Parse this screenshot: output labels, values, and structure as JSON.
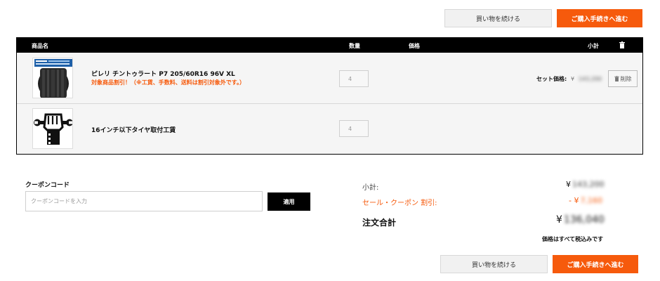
{
  "actions": {
    "continue_label": "買い物を続ける",
    "checkout_label": "ご購入手続きへ進む"
  },
  "cart": {
    "headers": {
      "product": "商品名",
      "quantity": "数量",
      "price": "価格",
      "subtotal": "小計",
      "trash_icon": "trash-icon"
    },
    "items": [
      {
        "name": "ピレリ チントゥラート P7 205/60R16 96V XL",
        "note": "対象商品割引！（※工賃、手数料、送料は割引対象外です。）",
        "quantity": "4",
        "set_price_label": "セット価格:",
        "set_price_currency": "¥",
        "set_price_value": "143,200",
        "delete_label": "削除",
        "image": "tire-icon"
      },
      {
        "name": "16インチ以下タイヤ取付工賃",
        "quantity": "4",
        "image": "wrench-fist-icon"
      }
    ]
  },
  "coupon": {
    "title": "クーポンコード",
    "placeholder": "クーポンコードを入力",
    "apply_label": "適用"
  },
  "summary": {
    "subtotal_label": "小計:",
    "subtotal_currency": "¥",
    "subtotal_value": "143,200",
    "discount_label": "セール・クーポン 割引:",
    "discount_currency": "- ¥",
    "discount_value": "7,160",
    "total_label": "注文合計",
    "total_currency": "¥",
    "total_value": "136,040",
    "tax_note": "価格はすべて税込みです"
  },
  "colors": {
    "accent": "#f65a0c",
    "header_bg": "#000000",
    "row_bg": "#f5f5f5"
  }
}
